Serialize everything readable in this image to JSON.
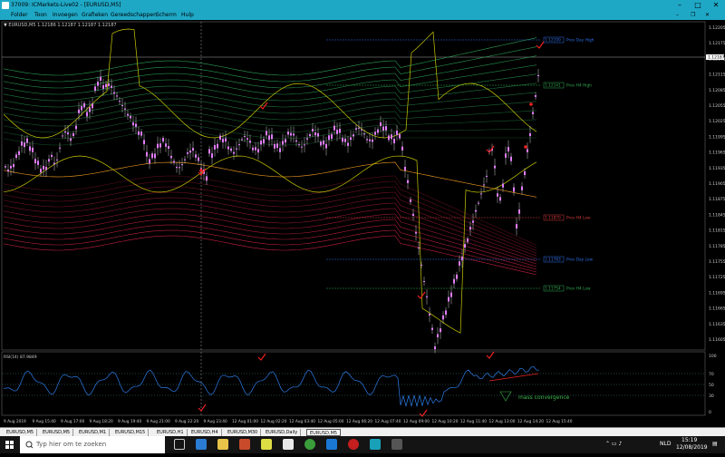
{
  "window": {
    "title": "37009: ICMarkets-Live02 - [EURUSD,M5]",
    "minimize": "–",
    "maximize": "□",
    "close": "✕",
    "sub_minimize": "–",
    "sub_restore": "❐",
    "sub_close": "✕"
  },
  "menu": {
    "items": [
      "Folder",
      "Toon",
      "Invoegen",
      "Grafieken",
      "Gereedschappen",
      "Scherm",
      "Hulp"
    ]
  },
  "chart": {
    "symbol_label": "▼ EURUSD,M5  1.12186 1.12187 1.12187 1.12187",
    "price_current": "1.12187",
    "price_ticks": [
      "1.12205",
      "1.12175",
      "1.12145",
      "1.12115",
      "1.12085",
      "1.12055",
      "1.12025",
      "1.11995",
      "1.11965",
      "1.11935",
      "1.11905",
      "1.11875",
      "1.11845",
      "1.11815",
      "1.11785",
      "1.11755",
      "1.11725",
      "1.11695",
      "1.11665",
      "1.11635",
      "1.11605"
    ],
    "time_ticks": [
      "9 Aug 2019",
      "9 Aug 15:40",
      "9 Aug 17:00",
      "9 Aug 18:20",
      "9 Aug 19:40",
      "9 Aug 21:00",
      "9 Aug 22:20",
      "9 Aug 23:40",
      "12 Aug 01:00",
      "12 Aug 02:20",
      "12 Aug 03:40",
      "12 Aug 05:00",
      "12 Aug 06:20",
      "12 Aug 07:40",
      "12 Aug 09:00",
      "12 Aug 10:20",
      "12 Aug 11:40",
      "12 Aug 13:00",
      "12 Aug 14:20",
      "12 Aug 15:40"
    ],
    "levels": [
      {
        "name": "Prev Day High",
        "value": "1.12190",
        "color": "#2d6ee8"
      },
      {
        "name": "Prev H4 High",
        "value": "1.12141",
        "color": "#2fa84f"
      },
      {
        "name": "Prev H4 Low",
        "value": "1.11870",
        "color": "#d23a3a"
      },
      {
        "name": "Prev Day Low",
        "value": "1.11783",
        "color": "#2d6ee8"
      },
      {
        "name": "Prev H4 Low",
        "value": "1.11754",
        "color": "#2fa84f"
      }
    ],
    "colors": {
      "candle": "#e27cff",
      "wick": "#ffffff",
      "yellow_band": "#c8c800",
      "green_band": "#2ea85a",
      "red_band": "#cc2244",
      "orange_band": "#d68a1e"
    }
  },
  "rsi": {
    "label": "RSI(14) 87.9849",
    "ticks": [
      "100",
      "70",
      "50",
      "30",
      "0"
    ],
    "annotation": "mass convergence",
    "line_color": "#2d7de8"
  },
  "tabs": [
    "EURUSD,M5",
    "EURUSD,M5",
    "EURUSD,M1",
    "EURUSD,M15",
    "EURUSD,H1",
    "EURUSD,H4",
    "EURUSD,M30",
    "EURUSD,Daily",
    "EURUSD,M5"
  ],
  "taskbar": {
    "search_placeholder": "Typ hier om te zoeken",
    "language": "NLD",
    "time": "15:19",
    "date": "12/08/2019"
  }
}
